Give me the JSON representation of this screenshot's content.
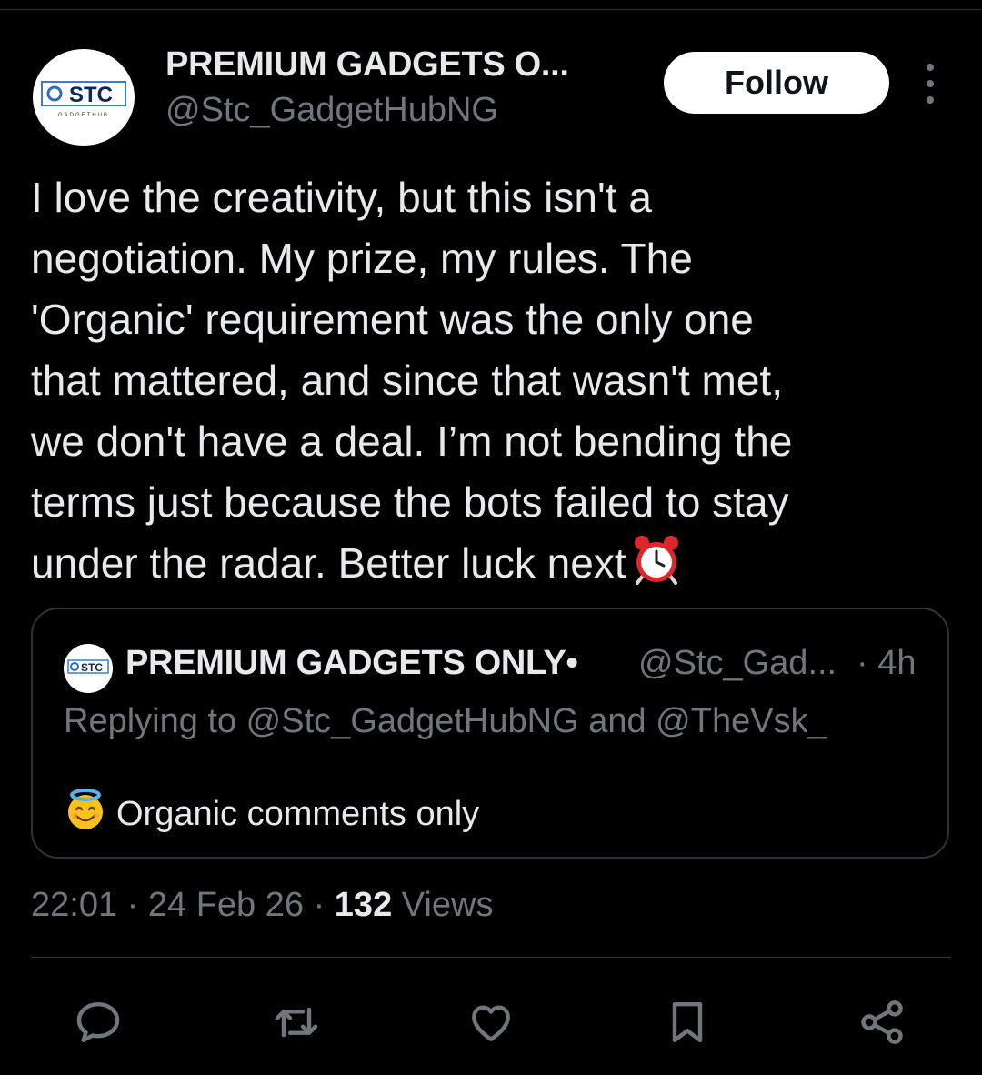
{
  "author": {
    "name": "PREMIUM GADGETS O...",
    "handle": "@Stc_GadgetHubNG",
    "avatar_text": "STC",
    "avatar_subtext": "GADGETHUB"
  },
  "follow_label": "Follow",
  "more_icon": "more-vertical-icon",
  "tweet": {
    "lines": [
      "I love the creativity, but this isn't a",
      "negotiation. My prize, my rules. The",
      "'Organic' requirement was the only one",
      "that mattered, and since that wasn't met,",
      "we don't have a deal. I’m not bending the",
      "terms just because the bots failed to stay",
      "under the radar. Better luck next"
    ],
    "trailing_emoji": "alarm-clock-icon"
  },
  "quote": {
    "name": "PREMIUM GADGETS ONLY•",
    "handle": "@Stc_Gad...",
    "time": "· 4h",
    "reply_context": "Replying to @Stc_GadgetHubNG and @TheVsk_",
    "text": "Organic comments only",
    "leading_emoji": "smiling-face-with-halo-icon"
  },
  "meta": {
    "time": "22:01",
    "sep1": "·",
    "date": "24 Feb 26",
    "sep2": "·",
    "views_count": "132",
    "views_label": "Views"
  },
  "actions": [
    {
      "name": "reply-icon"
    },
    {
      "name": "repost-icon"
    },
    {
      "name": "like-icon"
    },
    {
      "name": "bookmark-icon"
    },
    {
      "name": "share-icon"
    }
  ],
  "colors": {
    "background": "#000000",
    "text_primary": "#e7e9ea",
    "text_secondary": "#71767b",
    "border": "#2f3336",
    "follow_bg": "#ffffff",
    "follow_text": "#0f1419"
  }
}
